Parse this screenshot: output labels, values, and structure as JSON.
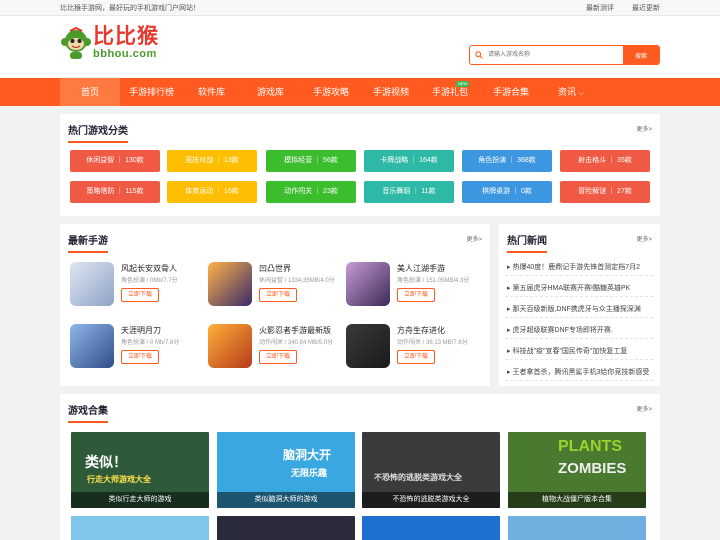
{
  "topbar": {
    "slogan": "比比猴手游网，最好玩的手机游戏门户网站！",
    "links": [
      "最新测评",
      "最近更新"
    ]
  },
  "logo": {
    "cn": "比比猴",
    "en": "bbhou.com"
  },
  "search": {
    "placeholder": "请输入游戏名称",
    "button": "搜索"
  },
  "nav": {
    "items": [
      "首页",
      "手游排行榜",
      "软件库",
      "游戏库",
      "手游攻略",
      "手游视频",
      "手游礼包",
      "手游合集",
      "资讯"
    ],
    "gift_tag": "NEW"
  },
  "hot": {
    "title": "热门游戏分类",
    "more": "更多>",
    "categories": [
      {
        "label": "休闲益智 ｜ 130款",
        "color": "#f05a44"
      },
      {
        "label": "竞技对战 ｜ 13款",
        "color": "#ffbe00"
      },
      {
        "label": "模拟经营 ｜ 56款",
        "color": "#3cbd2e"
      },
      {
        "label": "卡牌战略 ｜ 164款",
        "color": "#2db9a5"
      },
      {
        "label": "角色扮演 ｜ 368款",
        "color": "#3c96e0"
      },
      {
        "label": "射击格斗 ｜ 35款",
        "color": "#f05a44"
      },
      {
        "label": "策略塔防 ｜ 115款",
        "color": "#f05a44"
      },
      {
        "label": "体育运动 ｜ 16款",
        "color": "#ffbe00"
      },
      {
        "label": "动作闯关 ｜ 23款",
        "color": "#3cbd2e"
      },
      {
        "label": "音乐舞蹈 ｜ 11款",
        "color": "#2db9a5"
      },
      {
        "label": "棋牌桌游 ｜ 0款",
        "color": "#3c96e0"
      },
      {
        "label": "冒险解谜 ｜ 27款",
        "color": "#f05a44"
      }
    ]
  },
  "newgames": {
    "title": "最新手游",
    "more": "更多>",
    "download": "立即下载",
    "items": [
      {
        "name": "风起长安双骨人",
        "info": "角色扮演 / 0Mb/7.7分"
      },
      {
        "name": "凹凸世界",
        "info": "休闲益智 / 1334.35MB/4.0分"
      },
      {
        "name": "美人江湖手游",
        "info": "角色扮演 / 151.05MB/4.3分"
      },
      {
        "name": "天涯明月刀",
        "info": "角色扮演 / 0 Mb/7.6分"
      },
      {
        "name": "火影忍者手游最新版",
        "info": "动作闯关 / 340.84 MB/5.0分"
      },
      {
        "name": "方舟生存进化",
        "info": "动作闯关 / 36.13 MB/7.6分"
      }
    ]
  },
  "news": {
    "title": "热门新闻",
    "more": "更多>",
    "items": [
      "热爆40度！鹿鼎记手游先锋首测定档7月2",
      "第五届虎牙HMA联赛开赛!酷糖英雄PK",
      "那天百级新版,DNF携虎牙与众主播探深渊",
      "虎牙超级联赛DNF专场即将开赛.",
      "科技战\"疫\"宣春\"国民传奇\"加快复工复",
      "王者拿首杀，腾讯黑鲨手机3给你竞技新感受"
    ]
  },
  "topics": {
    "title": "游戏合集",
    "more": "更多>",
    "items": [
      {
        "caption": "类似行走大师的游戏",
        "art": "类似！",
        "art2": "行走大师游戏大全",
        "bg": "#2e5a3a"
      },
      {
        "caption": "类似脑洞大师的游戏",
        "art": "脑洞大开",
        "art2": "无限乐趣",
        "bg": "#3aa8e0"
      },
      {
        "caption": "不恐怖的逃脱类游戏大全",
        "art": "不恐怖的逃脱类游戏大全",
        "art2": "",
        "bg": "#3b3b3b"
      },
      {
        "caption": "植物大战僵尸版本合集",
        "art": "PLANTS",
        "art2": "ZOMBIES",
        "bg": "#4a7a30"
      }
    ]
  }
}
